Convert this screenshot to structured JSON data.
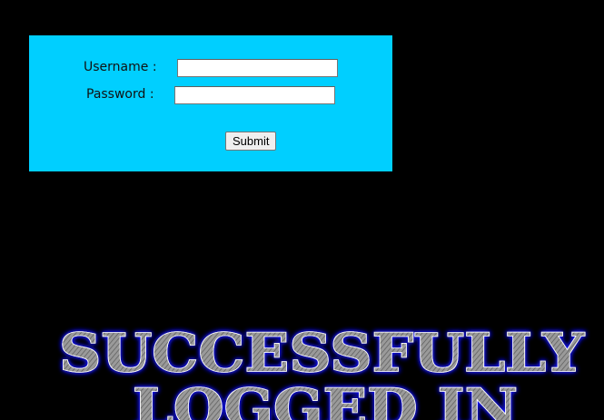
{
  "login_form": {
    "username_label": "Username :",
    "password_label": "Password :",
    "username_value": "",
    "password_value": "",
    "submit_label": "Submit"
  },
  "banner": {
    "line1": "SUCCESSFULLY",
    "line2": "LOGGED IN"
  },
  "colors": {
    "page_background": "#000000",
    "form_background": "#00cfff",
    "banner_text_fill": "#8c8c8c",
    "banner_glow": "#1a1aff"
  }
}
